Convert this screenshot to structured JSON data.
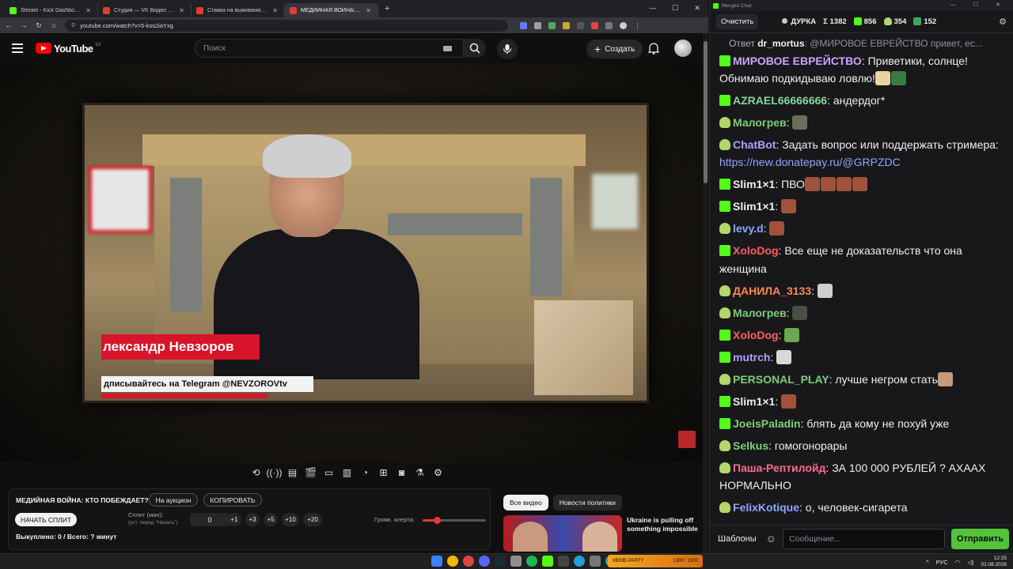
{
  "browser": {
    "tabs": [
      {
        "title": "Stream - Kick Dashboard",
        "color": "#53fc18"
      },
      {
        "title": "Студия — VK Видео Live",
        "color": "#e53935"
      },
      {
        "title": "Ставка на выживание. Как На",
        "color": "#e53935"
      },
      {
        "title": "МЕДИЙНАЯ ВОЙНА: КТО",
        "color": "#e53935"
      }
    ],
    "new_tab": "+",
    "url": "youtube.com/watch?v=5-kss2iaYxg"
  },
  "youtube": {
    "logo": "YouTube",
    "region": "LV",
    "search_placeholder": "Поиск",
    "create_label": "Создать",
    "video": {
      "lower_third_name": "лександр Невзоров",
      "lower_third_sub": "дписывайтесь на Telegram @NEVZOROVtv"
    },
    "panel": {
      "title": "МЕДИЙНАЯ ВОЙНА: КТО ПОБЕЖДАЕТ?",
      "auction_button": "На аукцион",
      "copy_button": "КОПИРОВАТЬ",
      "start_split_button": "НАЧАТЬ СПЛИТ",
      "split_label": "Сплит (мин):",
      "split_hint": "(уст. перед \"Начать\")",
      "split_value": "0",
      "steps": [
        "+1",
        "+3",
        "+5",
        "+10",
        "+20"
      ],
      "volume_label": "Громк. алерта:",
      "volume_level": 0.22,
      "status": "Выкуплено: 0 / Всего: ? минут"
    },
    "chips": [
      "Все видео",
      "Новости политики"
    ],
    "reco_title": "Ukraine is pulling off something impossible",
    "reco_overlay": "MEME-PARTY"
  },
  "chat": {
    "window_title": "Merged Chat",
    "clear_button": "Очистить",
    "streamer": "ДУРКА",
    "stats": [
      {
        "icon": "sigma",
        "value": "Σ 1382"
      },
      {
        "icon": "kick-icon",
        "value": "856"
      },
      {
        "icon": "twitch-icon",
        "value": "354"
      },
      {
        "icon": "other-icon",
        "value": "152"
      }
    ],
    "reply": {
      "prefix": "Ответ",
      "user": "dr_mortus",
      "text": ": @МИРОВОЕ ЕВРЕЙСТВО привет, ес..."
    },
    "messages": [
      {
        "badge": "kick",
        "user": "МИРОВОЕ ЕВРЕЙСТВО",
        "color": "#c9a6ff",
        "text": "Приветики, солнце! Обнимаю подкидываю ловлю!",
        "emotes": [
          "#e8d4a0",
          "#3b7a45"
        ]
      },
      {
        "badge": "kick",
        "user": "AZRAEL66666666",
        "color": "#86d6a0",
        "text": "андердог*",
        "emotes": []
      },
      {
        "badge": "twitch",
        "user": "Малогрев",
        "color": "#7fce77",
        "text": "",
        "emotes": [
          "#6b6f5a"
        ]
      },
      {
        "badge": "twitch",
        "user": "ChatBot",
        "color": "#b89bff",
        "text": "Задать вопрос или поддержать стримера: ",
        "link": "https://new.donatepay.ru/@GRPZDC",
        "emotes": []
      },
      {
        "badge": "kick",
        "user": "Slim1×1",
        "color": "#efeff1",
        "text": "ПВО",
        "emotes": [
          "#a0523c",
          "#a0523c",
          "#a0523c",
          "#a0523c"
        ]
      },
      {
        "badge": "kick",
        "user": "Slim1×1",
        "color": "#efeff1",
        "text": "",
        "emotes": [
          "#a0523c"
        ]
      },
      {
        "badge": "twitch",
        "user": "levy.d",
        "color": "#8da7ff",
        "text": "",
        "emotes": [
          "#a0523c"
        ]
      },
      {
        "badge": "kick",
        "user": "XoloDog",
        "color": "#ff5f5f",
        "text": "Все еще не доказательств что она женщина",
        "emotes": []
      },
      {
        "badge": "twitch",
        "user": "ДАНИЛА_3133",
        "color": "#ff8a4d",
        "text": "",
        "emotes": [
          "#cfcfcf"
        ]
      },
      {
        "badge": "twitch",
        "user": "Малогрев",
        "color": "#7fce77",
        "text": "",
        "emotes": [
          "#4a4f45"
        ]
      },
      {
        "badge": "kick",
        "user": "XoloDog",
        "color": "#ff5f5f",
        "text": "",
        "emotes": [
          "#6aa84f"
        ]
      },
      {
        "badge": "kick",
        "user": "mutrch",
        "color": "#b89bff",
        "text": "",
        "emotes": [
          "#d8d8d8"
        ]
      },
      {
        "badge": "twitch",
        "user": "PERSONAL_PLAY",
        "color": "#7fce77",
        "text": "лучше негром стать",
        "emotes": [
          "#c49a7a"
        ]
      },
      {
        "badge": "kick",
        "user": "Slim1×1",
        "color": "#efeff1",
        "text": "",
        "emotes": [
          "#a0523c"
        ]
      },
      {
        "badge": "kick",
        "user": "JoeisPaladin",
        "color": "#7fce77",
        "text": "блять да кому не похуй уже",
        "emotes": []
      },
      {
        "badge": "twitch",
        "user": "Selkus",
        "color": "#7fce77",
        "text": "гомогонорары",
        "emotes": []
      },
      {
        "badge": "twitch",
        "user": "Паша-Рептилойд",
        "color": "#ff6b8a",
        "text": "ЗА 100 000 РУБЛЕЙ ? АХААХ НОРМАЛЬНО",
        "emotes": []
      },
      {
        "badge": "twitch",
        "user": "FelixKotique",
        "color": "#8da7ff",
        "text": "о, человек-сигарета",
        "emotes": []
      }
    ],
    "templates_button": "Шаблоны",
    "input_placeholder": "Сообщение...",
    "send_button": "Отправить"
  },
  "taskbar": {
    "media_label": "1300 / 1300",
    "lang": "РУС",
    "time": "12:25",
    "date": "02.08.2026"
  }
}
